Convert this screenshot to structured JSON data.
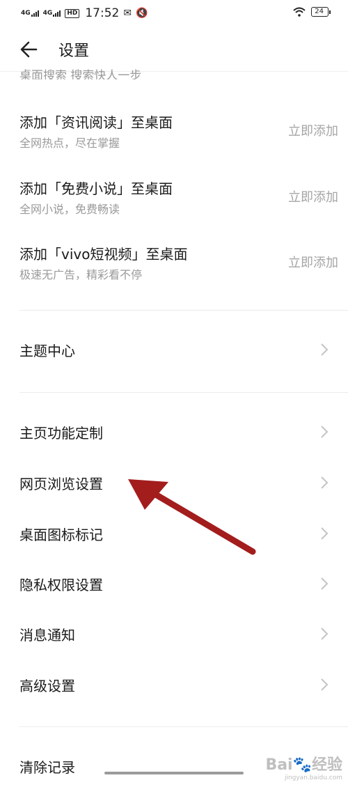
{
  "status_bar": {
    "signal1": "4G",
    "signal2": "4G",
    "hd": "HD",
    "time": "17:52",
    "battery": "24"
  },
  "header": {
    "title": "设置",
    "back_icon": "arrow-left-icon"
  },
  "clipped_row": {
    "text": "桌面搜索 搜索快人一步"
  },
  "add_rows": [
    {
      "title": "添加「资讯阅读」至桌面",
      "subtitle": "全网热点，尽在掌握",
      "action": "立即添加"
    },
    {
      "title": "添加「免费小说」至桌面",
      "subtitle": "全网小说，免费畅读",
      "action": "立即添加"
    },
    {
      "title": "添加「vivo短视频」至桌面",
      "subtitle": "极速无广告，精彩看不停",
      "action": "立即添加"
    }
  ],
  "menu": {
    "theme_center": "主题中心",
    "homepage_custom": "主页功能定制",
    "web_browse": "网页浏览设置",
    "desktop_icon_badge": "桌面图标标记",
    "privacy_permissions": "隐私权限设置",
    "notifications": "消息通知",
    "advanced": "高级设置",
    "clear_records": "清除记录"
  },
  "watermark": {
    "logo": "Bai🐾经验",
    "sub": "jingyan.baidu.com"
  },
  "colors": {
    "annotation_arrow": "#a31d1d",
    "secondary_text": "#9a9a9a",
    "divider": "#ececec"
  }
}
